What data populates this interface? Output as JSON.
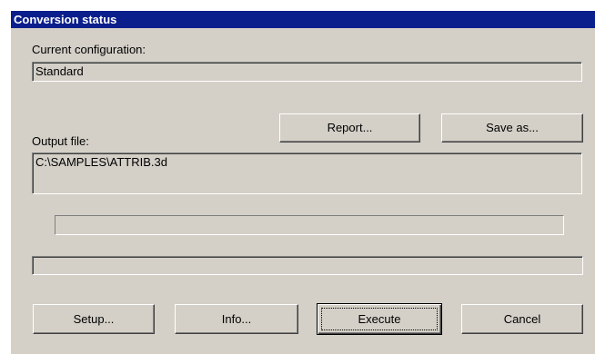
{
  "window": {
    "title": "Conversion status"
  },
  "configuration": {
    "label": "Current configuration:",
    "value": "Standard"
  },
  "output": {
    "label": "Output file:",
    "value": "C:\\SAMPLES\\ATTRIB.3d"
  },
  "buttons": {
    "report": "Report...",
    "save_as": "Save as...",
    "setup": "Setup...",
    "info": "Info...",
    "execute": "Execute",
    "cancel": "Cancel"
  },
  "progress": {
    "value": 0
  },
  "status": {
    "text": ""
  },
  "colors": {
    "title_bar": "#0a1e8c",
    "face": "#d4d0c8"
  }
}
